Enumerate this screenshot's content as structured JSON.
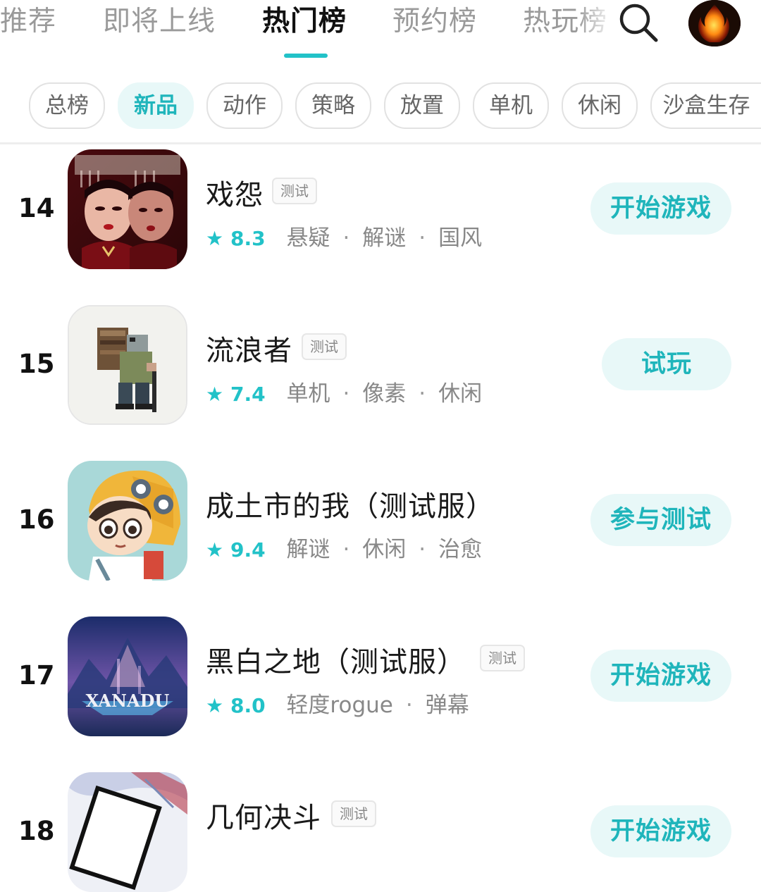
{
  "top_tabs": [
    "推荐",
    "即将上线",
    "热门榜",
    "预约榜",
    "热玩榜"
  ],
  "categories": [
    "总榜",
    "新品",
    "动作",
    "策略",
    "放置",
    "单机",
    "休闲",
    "沙盒生存"
  ],
  "games": [
    {
      "rank": "14",
      "name": "戏怨",
      "badge": "测试",
      "rating": "8.3",
      "tags": [
        "悬疑",
        "解谜",
        "国风"
      ],
      "action": "开始游戏"
    },
    {
      "rank": "15",
      "name": "流浪者",
      "badge": "测试",
      "rating": "7.4",
      "tags": [
        "单机",
        "像素",
        "休闲"
      ],
      "action": "试玩"
    },
    {
      "rank": "16",
      "name": "成土市的我（测试服）",
      "badge": "",
      "rating": "9.4",
      "tags": [
        "解谜",
        "休闲",
        "治愈"
      ],
      "action": "参与测试"
    },
    {
      "rank": "17",
      "name": "黑白之地（测试服）",
      "badge": "测试",
      "rating": "8.0",
      "tags": [
        "轻度rogue",
        "弹幕"
      ],
      "action": "开始游戏",
      "icon_text": "XANADU"
    },
    {
      "rank": "18",
      "name": "几何决斗",
      "badge": "测试",
      "rating": "",
      "tags": [],
      "action": "开始游戏"
    }
  ],
  "icons": {
    "search": "search-icon",
    "star": "star-icon"
  },
  "colors": {
    "accent": "#22c2c8",
    "accent_bg": "#e8f8f8",
    "muted_text": "#888888"
  }
}
